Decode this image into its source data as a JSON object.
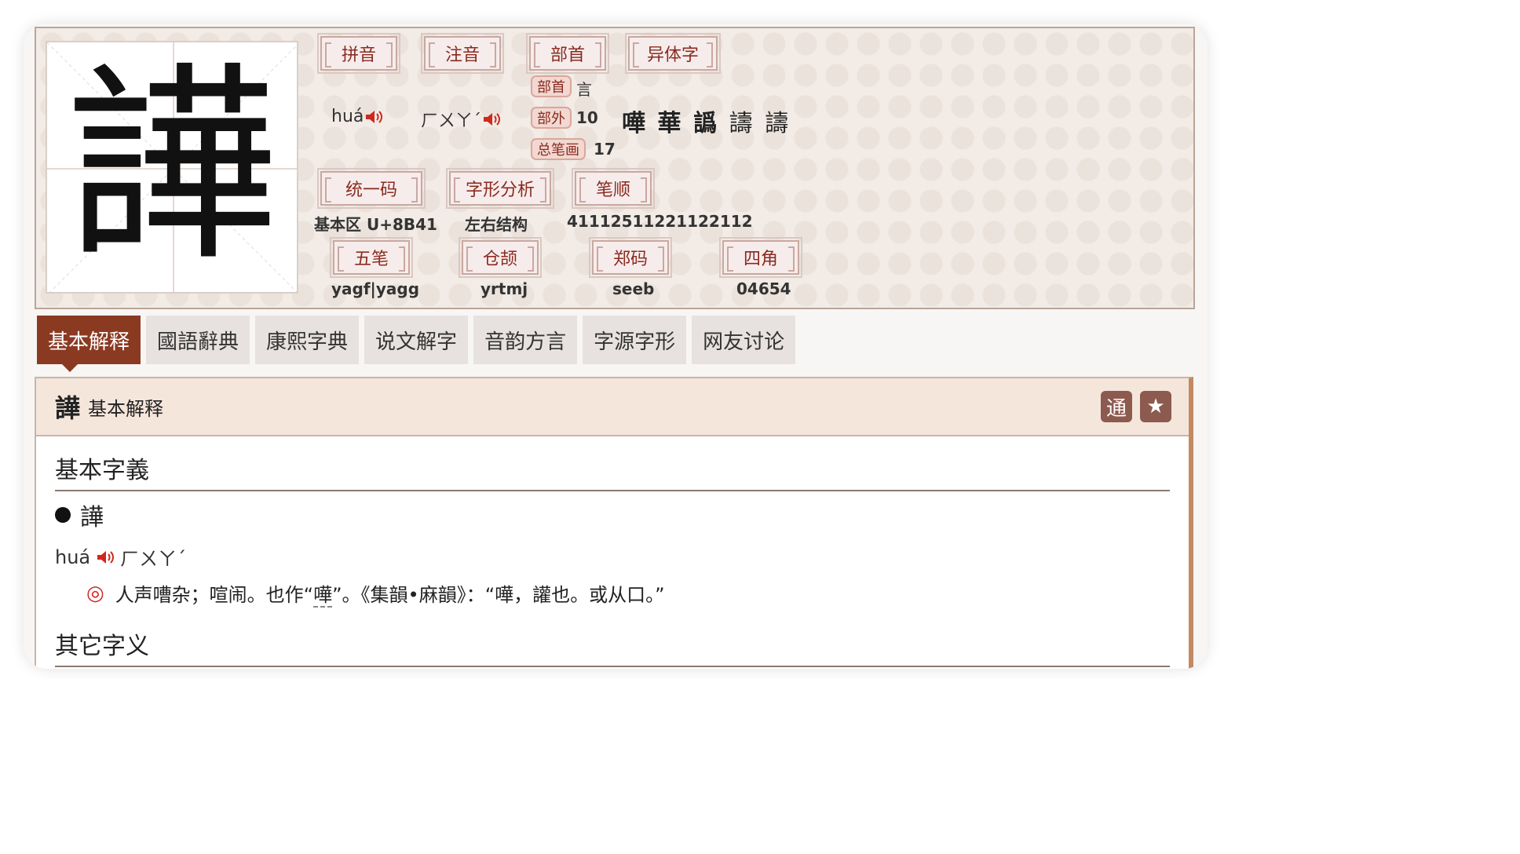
{
  "character": "譁",
  "info": {
    "labels": {
      "pinyin": "拼音",
      "zhuyin": "注音",
      "radical": "部首",
      "variants": "异体字",
      "unicode": "统一码",
      "structure": "字形分析",
      "stroke_order": "笔顺",
      "wubi": "五笔",
      "cangjie": "仓颉",
      "zhengma": "郑码",
      "four_corner": "四角"
    },
    "pinyin": "huá",
    "zhuyin": "ㄏㄨㄚˊ",
    "radical_pill": "部首",
    "radical": "言",
    "outside_pill": "部外",
    "outside_strokes": "10",
    "total_pill": "总笔画",
    "total_strokes": "17",
    "variants": [
      "嘩",
      "華",
      "譌",
      "譸",
      "譸"
    ],
    "unicode": "基本区 U+8B41",
    "structure": "左右结构",
    "stroke_order": "41112511221122112",
    "wubi": "yagf|yagg",
    "cangjie": "yrtmj",
    "zhengma": "seeb",
    "four_corner": "04654"
  },
  "tabs": [
    "基本解释",
    "國語辭典",
    "康熙字典",
    "说文解字",
    "音韵方言",
    "字源字形",
    "网友讨论"
  ],
  "active_tab": 0,
  "content": {
    "head_char": "譁",
    "head_title": "基本解释",
    "btn_tong": "通",
    "btn_star": "★",
    "section1": "基本字義",
    "entry_char": "譁",
    "entry_pinyin": "huá",
    "entry_zhuyin": "ㄏㄨㄚˊ",
    "def_mark": "◎",
    "def_text_a": "人声嘈杂；喧闹。也作“",
    "def_text_link": "嘩",
    "def_text_b": "”。《集韻•麻韻》：“嘩，讙也。或从口。”",
    "section2": "其它字义"
  },
  "colors": {
    "accent": "#8b3a22",
    "tag_text": "#8a2b1f",
    "speaker": "#d0281e"
  }
}
